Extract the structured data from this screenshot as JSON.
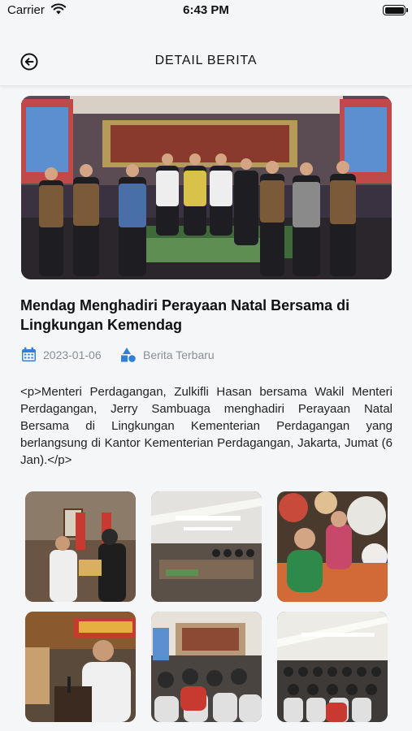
{
  "status_bar": {
    "carrier": "Carrier",
    "time": "6:43 PM"
  },
  "header": {
    "title": "DETAIL BERITA"
  },
  "article": {
    "title": "Mendag Menghadiri Perayaan Natal Bersama di Lingkungan Kemendag",
    "date": "2023-01-06",
    "category": "Berita Terbaru",
    "body": "<p>Menteri Perdagangan, Zulkifli Hasan bersama Wakil Menteri Perdagangan, Jerry Sambuaga menghadiri Perayaan Natal Bersama di Lingkungan Kementerian Perdagangan yang berlangsung di Kantor Kementerian Perdagangan, Jakarta, Jumat (6 Jan).</p>"
  },
  "colors": {
    "accent": "#2f80d6",
    "meta_text": "#8a8f96",
    "background": "#f4f6f8"
  },
  "icons": {
    "back": "circle-arrow-left-icon",
    "date": "calendar-icon",
    "category": "shapes-icon",
    "wifi": "wifi-icon",
    "battery": "battery-icon"
  }
}
